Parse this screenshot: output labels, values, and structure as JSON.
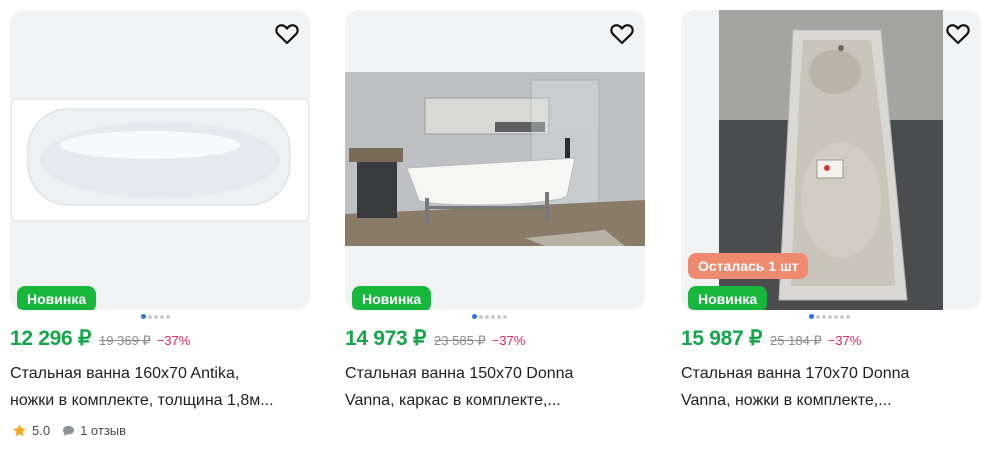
{
  "products": [
    {
      "price": "12 296 ₽",
      "old_price": "19 369 ₽",
      "discount": "−37%",
      "title_line1": "Стальная ванна 160x70 Antika,",
      "title_line2": "ножки в комплекте, толщина 1,8м...",
      "badge_new": "Новинка",
      "rating": "5.0",
      "reviews": "1 отзыв"
    },
    {
      "price": "14 973 ₽",
      "old_price": "23 585 ₽",
      "discount": "−37%",
      "title_line1": "Стальная ванна 150x70 Donna",
      "title_line2": "Vanna, каркас в комплекте,...",
      "badge_new": "Новинка"
    },
    {
      "price": "15 987 ₽",
      "old_price": "25 184 ₽",
      "discount": "−37%",
      "title_line1": "Стальная ванна 170x70 Donna",
      "title_line2": "Vanna, ножки в комплекте,...",
      "badge_stock": "Осталась 1 шт",
      "badge_new": "Новинка"
    }
  ],
  "colors": {
    "price": "#17a64c",
    "discount": "#e4275a",
    "badge_new": "#17b73c",
    "badge_stock": "#f08a6e",
    "active_dot": "#2f6fe0"
  }
}
